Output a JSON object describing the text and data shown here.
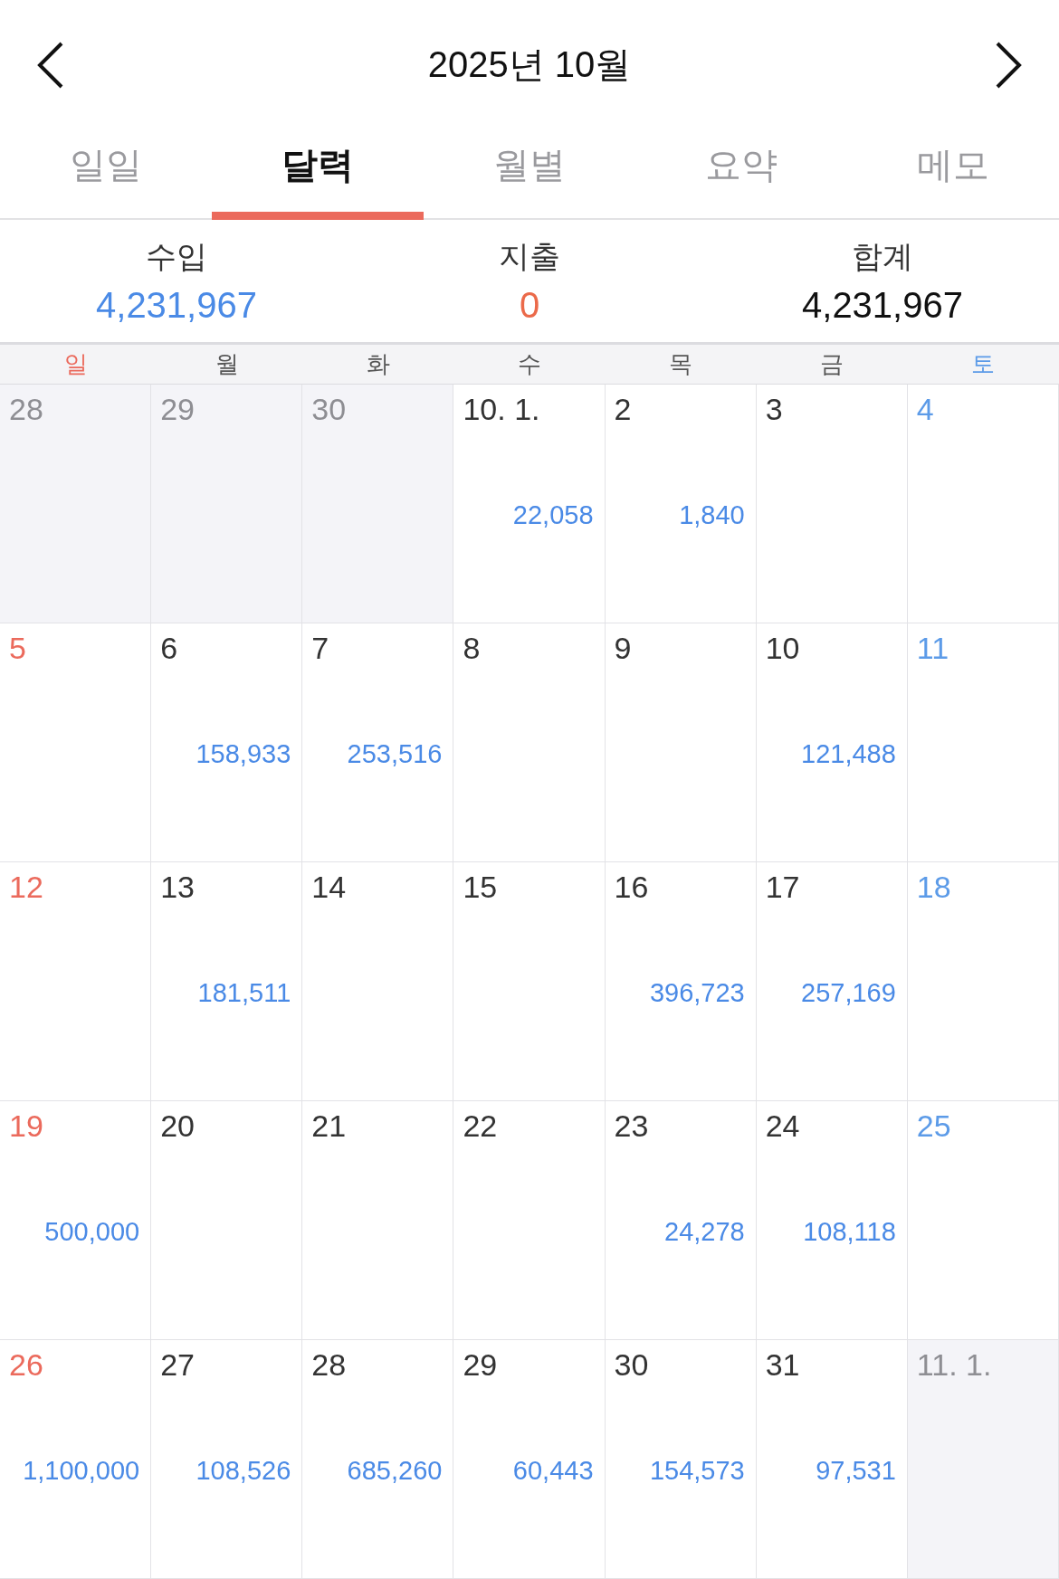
{
  "header": {
    "title": "2025년 10월"
  },
  "tabs": [
    {
      "label": "일일",
      "selected": false
    },
    {
      "label": "달력",
      "selected": true
    },
    {
      "label": "월별",
      "selected": false
    },
    {
      "label": "요약",
      "selected": false
    },
    {
      "label": "메모",
      "selected": false
    }
  ],
  "summary": [
    {
      "label": "수입",
      "value": "4,231,967",
      "kind": "income"
    },
    {
      "label": "지출",
      "value": "0",
      "kind": "expense"
    },
    {
      "label": "합계",
      "value": "4,231,967",
      "kind": "total"
    }
  ],
  "weekdays": [
    "일",
    "월",
    "화",
    "수",
    "목",
    "금",
    "토"
  ],
  "days": [
    {
      "label": "28",
      "other_month": true
    },
    {
      "label": "29",
      "other_month": true
    },
    {
      "label": "30",
      "other_month": true
    },
    {
      "label": "10. 1.",
      "other_month": false,
      "amount": "22,058"
    },
    {
      "label": "2",
      "other_month": false,
      "amount": "1,840"
    },
    {
      "label": "3",
      "other_month": false
    },
    {
      "label": "4",
      "other_month": false
    },
    {
      "label": "5",
      "other_month": false
    },
    {
      "label": "6",
      "other_month": false,
      "amount": "158,933"
    },
    {
      "label": "7",
      "other_month": false,
      "amount": "253,516"
    },
    {
      "label": "8",
      "other_month": false
    },
    {
      "label": "9",
      "other_month": false
    },
    {
      "label": "10",
      "other_month": false,
      "amount": "121,488"
    },
    {
      "label": "11",
      "other_month": false
    },
    {
      "label": "12",
      "other_month": false
    },
    {
      "label": "13",
      "other_month": false,
      "amount": "181,511"
    },
    {
      "label": "14",
      "other_month": false
    },
    {
      "label": "15",
      "other_month": false
    },
    {
      "label": "16",
      "other_month": false,
      "amount": "396,723"
    },
    {
      "label": "17",
      "other_month": false,
      "amount": "257,169"
    },
    {
      "label": "18",
      "other_month": false
    },
    {
      "label": "19",
      "other_month": false,
      "amount": "500,000"
    },
    {
      "label": "20",
      "other_month": false
    },
    {
      "label": "21",
      "other_month": false
    },
    {
      "label": "22",
      "other_month": false
    },
    {
      "label": "23",
      "other_month": false,
      "amount": "24,278"
    },
    {
      "label": "24",
      "other_month": false,
      "amount": "108,118"
    },
    {
      "label": "25",
      "other_month": false
    },
    {
      "label": "26",
      "other_month": false,
      "amount": "1,100,000"
    },
    {
      "label": "27",
      "other_month": false,
      "amount": "108,526"
    },
    {
      "label": "28",
      "other_month": false,
      "amount": "685,260"
    },
    {
      "label": "29",
      "other_month": false,
      "amount": "60,443"
    },
    {
      "label": "30",
      "other_month": false,
      "amount": "154,573"
    },
    {
      "label": "31",
      "other_month": false,
      "amount": "97,531"
    },
    {
      "label": "11. 1.",
      "other_month": true
    }
  ]
}
